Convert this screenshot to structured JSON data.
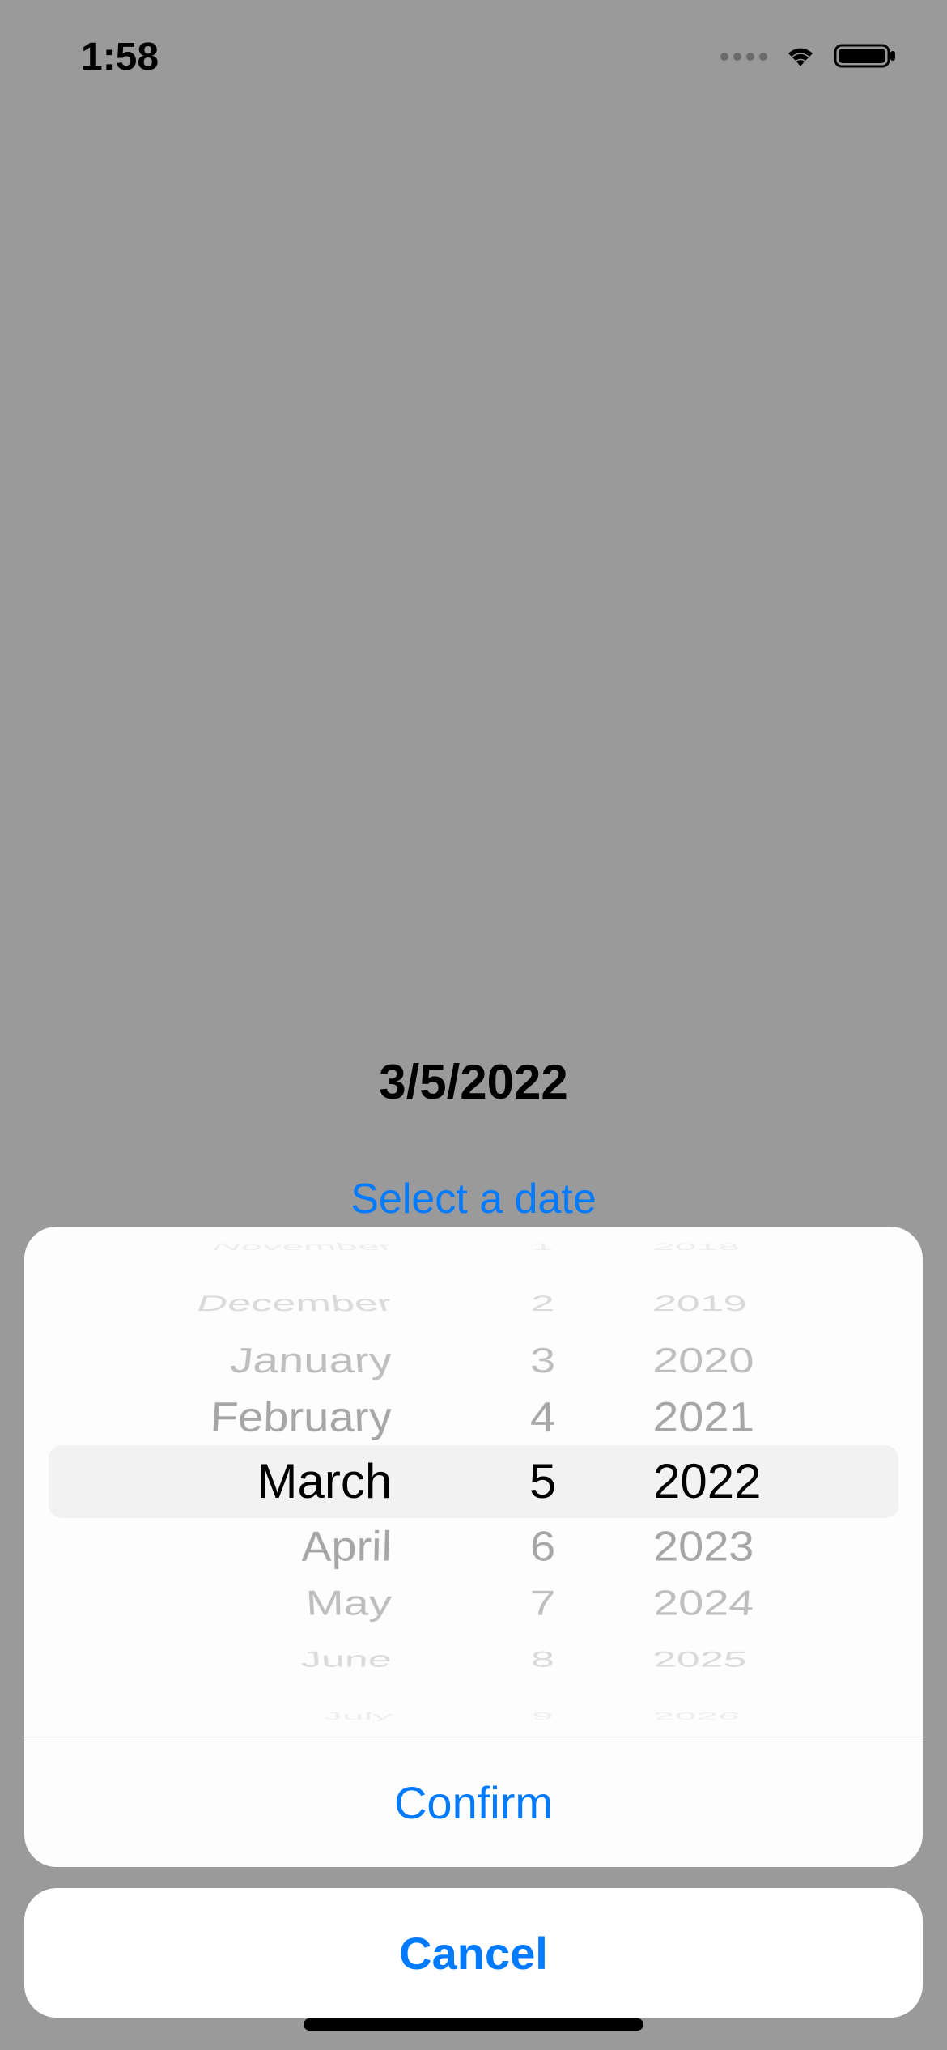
{
  "status_bar": {
    "time": "1:58"
  },
  "main": {
    "date_display": "3/5/2022",
    "select_link": "Select a date"
  },
  "picker": {
    "months": {
      "far_above2": "November",
      "far_above": "December",
      "above2": "January",
      "above1": "February",
      "selected": "March",
      "below1": "April",
      "below2": "May",
      "far_below": "June",
      "far_below2": "July"
    },
    "days": {
      "far_above2": "1",
      "far_above": "2",
      "above2": "3",
      "above1": "4",
      "selected": "5",
      "below1": "6",
      "below2": "7",
      "far_below": "8",
      "far_below2": "9"
    },
    "years": {
      "far_above2": "2018",
      "far_above": "2019",
      "above2": "2020",
      "above1": "2021",
      "selected": "2022",
      "below1": "2023",
      "below2": "2024",
      "far_below": "2025",
      "far_below2": "2026"
    }
  },
  "actions": {
    "confirm": "Confirm",
    "cancel": "Cancel"
  },
  "colors": {
    "accent": "#007aff",
    "dim_background": "#9a9a9a"
  }
}
